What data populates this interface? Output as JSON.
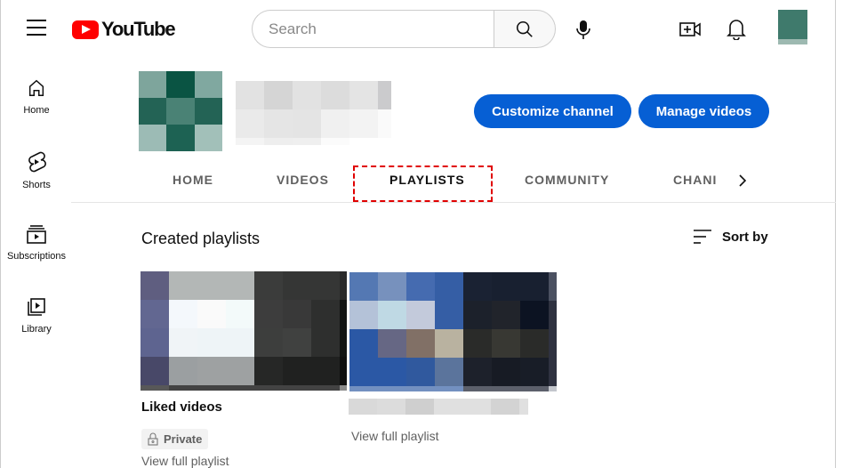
{
  "header": {
    "logo_text": "YouTube",
    "search_placeholder": "Search"
  },
  "sidebar": {
    "items": [
      {
        "label": "Home",
        "icon": "home-icon"
      },
      {
        "label": "Shorts",
        "icon": "shorts-icon"
      },
      {
        "label": "Subscriptions",
        "icon": "subscriptions-icon"
      },
      {
        "label": "Library",
        "icon": "library-icon"
      }
    ]
  },
  "channel": {
    "customize_label": "Customize channel",
    "manage_label": "Manage videos"
  },
  "tabs": [
    {
      "label": "HOME"
    },
    {
      "label": "VIDEOS"
    },
    {
      "label": "PLAYLISTS",
      "active": true
    },
    {
      "label": "COMMUNITY"
    },
    {
      "label": "CHANI"
    }
  ],
  "section": {
    "title": "Created playlists",
    "sort_label": "Sort by"
  },
  "playlists": [
    {
      "title": "Liked videos",
      "badge": "Private",
      "link": "View full playlist"
    },
    {
      "title": "",
      "link": "View full playlist"
    }
  ]
}
